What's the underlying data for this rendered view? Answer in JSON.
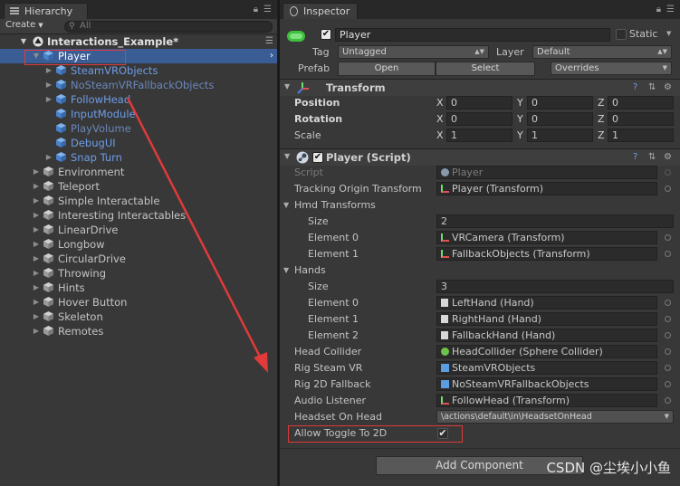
{
  "hierarchy": {
    "tab_label": "Hierarchy",
    "create_label": "Create",
    "search_placeholder": "All",
    "scene_name": "Interactions_Example*",
    "items": [
      {
        "label": "Player",
        "level": 1,
        "fold": "open",
        "style": "blue",
        "selected": true
      },
      {
        "label": "SteamVRObjects",
        "level": 2,
        "fold": "closed",
        "style": "blue"
      },
      {
        "label": "NoSteamVRFallbackObjects",
        "level": 2,
        "fold": "closed",
        "style": "dim"
      },
      {
        "label": "FollowHead",
        "level": 2,
        "fold": "closed",
        "style": "blue"
      },
      {
        "label": "InputModule",
        "level": 2,
        "fold": "none",
        "style": "blue"
      },
      {
        "label": "PlayVolume",
        "level": 2,
        "fold": "none",
        "style": "dim"
      },
      {
        "label": "DebugUI",
        "level": 2,
        "fold": "none",
        "style": "blue"
      },
      {
        "label": "Snap Turn",
        "level": 2,
        "fold": "closed",
        "style": "blue"
      },
      {
        "label": "Environment",
        "level": 1,
        "fold": "closed",
        "style": "grey"
      },
      {
        "label": "Teleport",
        "level": 1,
        "fold": "closed",
        "style": "grey"
      },
      {
        "label": "Simple Interactable",
        "level": 1,
        "fold": "closed",
        "style": "grey"
      },
      {
        "label": "Interesting Interactables",
        "level": 1,
        "fold": "closed",
        "style": "grey"
      },
      {
        "label": "LinearDrive",
        "level": 1,
        "fold": "closed",
        "style": "grey"
      },
      {
        "label": "Longbow",
        "level": 1,
        "fold": "closed",
        "style": "grey"
      },
      {
        "label": "CircularDrive",
        "level": 1,
        "fold": "closed",
        "style": "grey"
      },
      {
        "label": "Throwing",
        "level": 1,
        "fold": "closed",
        "style": "grey"
      },
      {
        "label": "Hints",
        "level": 1,
        "fold": "closed",
        "style": "grey"
      },
      {
        "label": "Hover Button",
        "level": 1,
        "fold": "closed",
        "style": "grey"
      },
      {
        "label": "Skeleton",
        "level": 1,
        "fold": "closed",
        "style": "grey"
      },
      {
        "label": "Remotes",
        "level": 1,
        "fold": "closed",
        "style": "grey"
      }
    ]
  },
  "inspector": {
    "tab_label": "Inspector",
    "object_name": "Player",
    "static_label": "Static",
    "tag_label": "Tag",
    "tag_value": "Untagged",
    "layer_label": "Layer",
    "layer_value": "Default",
    "prefab_label": "Prefab",
    "open_label": "Open",
    "select_label": "Select",
    "overrides_label": "Overrides",
    "transform": {
      "title": "Transform",
      "position_label": "Position",
      "rotation_label": "Rotation",
      "scale_label": "Scale",
      "position": [
        "0",
        "0",
        "0"
      ],
      "rotation": [
        "0",
        "0",
        "0"
      ],
      "scale": [
        "1",
        "1",
        "1"
      ],
      "axis": [
        "X",
        "Y",
        "Z"
      ]
    },
    "script": {
      "title": "Player (Script)",
      "script_label": "Script",
      "script_value": "Player",
      "tracking_label": "Tracking Origin Transform",
      "tracking_value": "Player (Transform)",
      "hmd_label": "Hmd Transforms",
      "size_label": "Size",
      "hmd_size": "2",
      "hmd_elements": [
        {
          "label": "Element 0",
          "value": "VRCamera (Transform)"
        },
        {
          "label": "Element 1",
          "value": "FallbackObjects (Transform)"
        }
      ],
      "hands_label": "Hands",
      "hands_size": "3",
      "hands_elements": [
        {
          "label": "Element 0",
          "value": "LeftHand (Hand)"
        },
        {
          "label": "Element 1",
          "value": "RightHand (Hand)"
        },
        {
          "label": "Element 2",
          "value": "FallbackHand (Hand)"
        }
      ],
      "head_collider_label": "Head Collider",
      "head_collider_value": "HeadCollider (Sphere Collider)",
      "rig_steam_label": "Rig Steam VR",
      "rig_steam_value": "SteamVRObjects",
      "rig_2d_label": "Rig 2D Fallback",
      "rig_2d_value": "NoSteamVRFallbackObjects",
      "audio_label": "Audio Listener",
      "audio_value": "FollowHead (Transform)",
      "headset_label": "Headset On Head",
      "headset_value": "\\actions\\default\\in\\HeadsetOnHead",
      "toggle_label": "Allow Toggle To 2D",
      "toggle_checked": true
    },
    "add_component_label": "Add Component"
  },
  "watermark": "CSDN @尘埃小小鱼",
  "colors": {
    "highlight": "#e03a3a",
    "selection": "#3b5d96",
    "prefab_blue": "#6d9de8"
  }
}
